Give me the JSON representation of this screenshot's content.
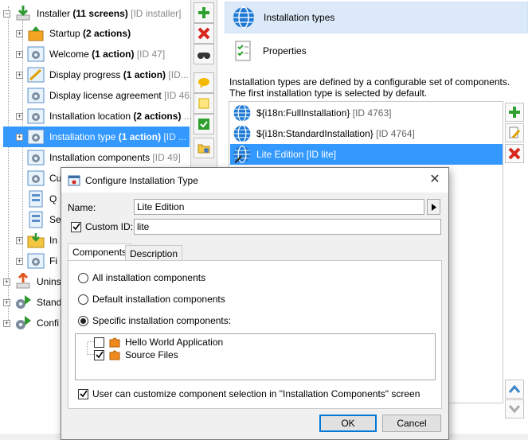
{
  "tree": {
    "nodes": [
      {
        "label": "Installer",
        "bold": "(11 screens)",
        "id": "[ID installer]"
      },
      {
        "label": "Startup",
        "bold": "(2 actions)",
        "id": ""
      },
      {
        "label": "Welcome",
        "bold": "(1 action)",
        "id": "[ID 47]"
      },
      {
        "label": "Display progress",
        "bold": "(1 action)",
        "id": "[ID..."
      },
      {
        "label": "Display license agreement",
        "bold": "",
        "id": "[ID 46..."
      },
      {
        "label": "Installation location",
        "bold": "(2 actions)",
        "id": "..."
      },
      {
        "label": "Installation type",
        "bold": "(1 action)",
        "id": "[ID ..."
      },
      {
        "label": "Installation components",
        "bold": "",
        "id": "[ID 49]"
      },
      {
        "label": "Cu",
        "bold": "",
        "id": ""
      },
      {
        "label": "Q",
        "bold": "",
        "id": ""
      },
      {
        "label": "Se",
        "bold": "",
        "id": ""
      },
      {
        "label": "In",
        "bold": "",
        "id": ""
      },
      {
        "label": "Fi",
        "bold": "",
        "id": ""
      },
      {
        "label": "Unins",
        "bold": "",
        "id": ""
      },
      {
        "label": "Stand",
        "bold": "",
        "id": ""
      },
      {
        "label": "Confi",
        "bold": "",
        "id": ""
      }
    ]
  },
  "right_pane": {
    "nav_installation_types": "Installation types",
    "nav_properties": "Properties",
    "description": "Installation types are defined by a configurable set of components. The first installation type is selected by default.",
    "types": [
      {
        "label": "${i18n:FullInstallation}",
        "id": "[ID 4763]"
      },
      {
        "label": "${i18n:StandardInstallation}",
        "id": "[ID 4764]"
      },
      {
        "label": "Lite Edition",
        "id": "[ID lite]"
      }
    ]
  },
  "dialog": {
    "title": "Configure Installation Type",
    "name_label": "Name:",
    "name_value": "Lite Edition",
    "custom_id_label": "Custom ID:",
    "custom_id_value": "lite",
    "tab_components": "Components",
    "tab_description": "Description",
    "radio_all": "All installation components",
    "radio_default": "Default installation components",
    "radio_specific": "Specific installation components:",
    "components": [
      {
        "label": "Hello World Application",
        "checked": false
      },
      {
        "label": "Source Files",
        "checked": true
      }
    ],
    "user_customize_label": "User can customize component selection in \"Installation Components\" screen",
    "ok_label": "OK",
    "cancel_label": "Cancel"
  },
  "colors": {
    "selection": "#3399ff",
    "nav_active_bg": "#dbe9f9",
    "ok_border": "#0078d7"
  }
}
